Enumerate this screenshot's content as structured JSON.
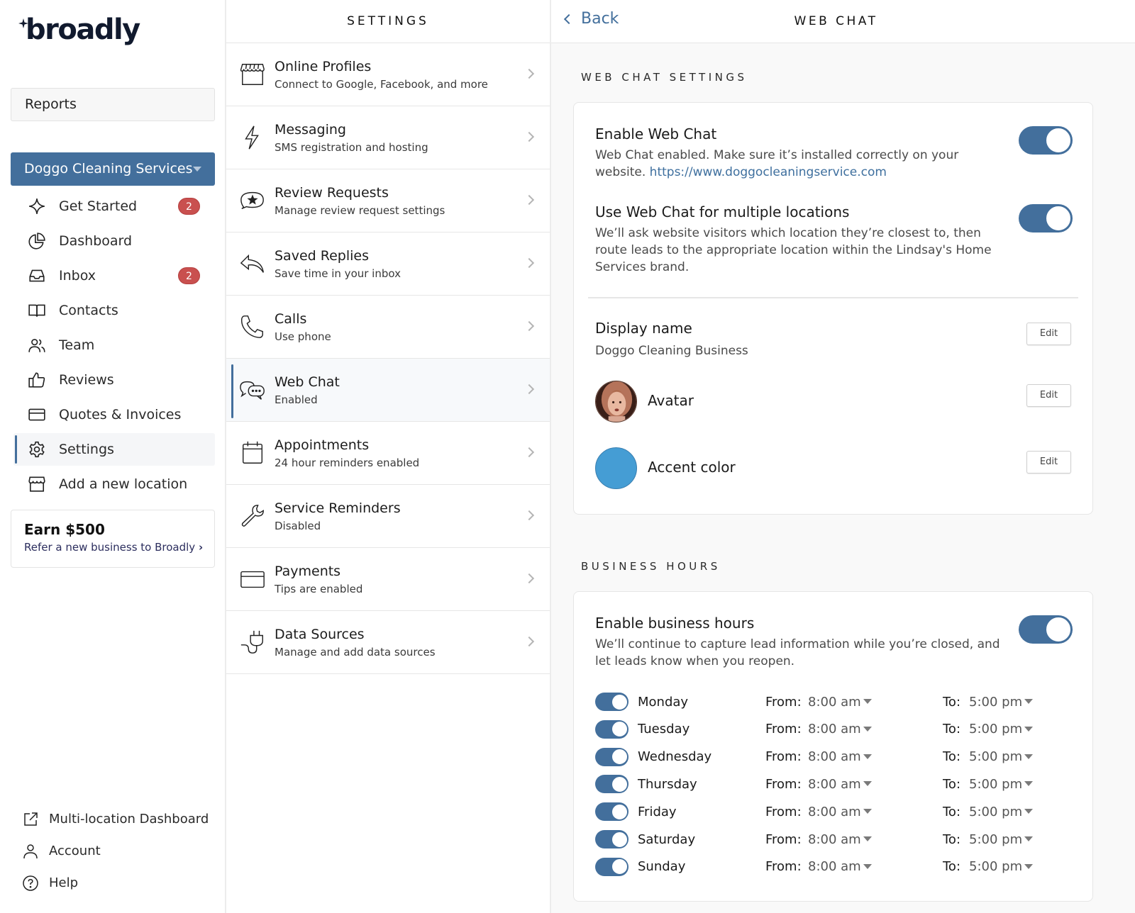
{
  "brand": {
    "name": "broadly",
    "primary_color": "#436f9c",
    "badge_color": "#c9504f"
  },
  "sidebar": {
    "reports_label": "Reports",
    "location": "Doggo Cleaning Services",
    "items": [
      {
        "label": "Get Started",
        "icon": "sparkle-icon",
        "badge": "2"
      },
      {
        "label": "Dashboard",
        "icon": "pie-chart-icon"
      },
      {
        "label": "Inbox",
        "icon": "inbox-icon",
        "badge": "2"
      },
      {
        "label": "Contacts",
        "icon": "book-icon"
      },
      {
        "label": "Team",
        "icon": "team-icon"
      },
      {
        "label": "Reviews",
        "icon": "thumbs-up-icon"
      },
      {
        "label": "Quotes & Invoices",
        "icon": "card-icon"
      },
      {
        "label": "Settings",
        "icon": "gear-icon",
        "active": true
      },
      {
        "label": "Add a new location",
        "icon": "storefront-icon"
      }
    ],
    "earn": {
      "title": "Earn $500",
      "link": "Refer a new business to Broadly"
    },
    "bottom": [
      {
        "label": "Multi-location Dashboard",
        "icon": "external-link-icon"
      },
      {
        "label": "Account",
        "icon": "user-icon"
      },
      {
        "label": "Help",
        "icon": "help-icon"
      }
    ]
  },
  "settings": {
    "header": "SETTINGS",
    "items": [
      {
        "title": "Online Profiles",
        "subtitle": "Connect to Google, Facebook, and more",
        "icon": "storefront-icon"
      },
      {
        "title": "Messaging",
        "subtitle": "SMS registration and hosting",
        "icon": "lightning-icon"
      },
      {
        "title": "Review Requests",
        "subtitle": "Manage review request settings",
        "icon": "star-chat-icon"
      },
      {
        "title": "Saved Replies",
        "subtitle": "Save time in your inbox",
        "icon": "reply-icon"
      },
      {
        "title": "Calls",
        "subtitle": "Use phone",
        "icon": "phone-icon"
      },
      {
        "title": "Web Chat",
        "subtitle": "Enabled",
        "icon": "chat-bubbles-icon",
        "active": true
      },
      {
        "title": "Appointments",
        "subtitle": "24 hour reminders enabled",
        "icon": "calendar-icon"
      },
      {
        "title": "Service Reminders",
        "subtitle": "Disabled",
        "icon": "wrench-icon"
      },
      {
        "title": "Payments",
        "subtitle": "Tips are enabled",
        "icon": "card-icon"
      },
      {
        "title": "Data Sources",
        "subtitle": "Manage and add data sources",
        "icon": "plug-icon"
      }
    ]
  },
  "detail": {
    "back_label": "Back",
    "title": "WEB CHAT",
    "webchat_section": "WEB CHAT SETTINGS",
    "enable": {
      "title": "Enable Web Chat",
      "desc": "Web Chat enabled. Make sure it’s installed correctly on your website.",
      "url": "https://www.doggocleaningservice.com",
      "on": true
    },
    "multi": {
      "title": "Use Web Chat for multiple locations",
      "desc": "We’ll ask website visitors which location they’re closest to, then route leads to the appropriate location within the Lindsay's Home Services brand.",
      "on": true
    },
    "display_name": {
      "label": "Display name",
      "value": "Doggo Cleaning Business",
      "edit": "Edit"
    },
    "avatar": {
      "label": "Avatar",
      "edit": "Edit"
    },
    "accent": {
      "label": "Accent color",
      "value": "#459dd4",
      "edit": "Edit"
    },
    "hours_section": "BUSINESS HOURS",
    "hours": {
      "title": "Enable business hours",
      "desc": "We’ll continue to capture lead information while you’re closed, and let leads know when you reopen.",
      "on": true,
      "from_label": "From:",
      "to_label": "To:",
      "days": [
        {
          "day": "Monday",
          "from": "8:00 am",
          "to": "5:00 pm",
          "on": true
        },
        {
          "day": "Tuesday",
          "from": "8:00 am",
          "to": "5:00 pm",
          "on": true
        },
        {
          "day": "Wednesday",
          "from": "8:00 am",
          "to": "5:00 pm",
          "on": true
        },
        {
          "day": "Thursday",
          "from": "8:00 am",
          "to": "5:00 pm",
          "on": true
        },
        {
          "day": "Friday",
          "from": "8:00 am",
          "to": "5:00 pm",
          "on": true
        },
        {
          "day": "Saturday",
          "from": "8:00 am",
          "to": "5:00 pm",
          "on": true
        },
        {
          "day": "Sunday",
          "from": "8:00 am",
          "to": "5:00 pm",
          "on": true
        }
      ]
    }
  }
}
